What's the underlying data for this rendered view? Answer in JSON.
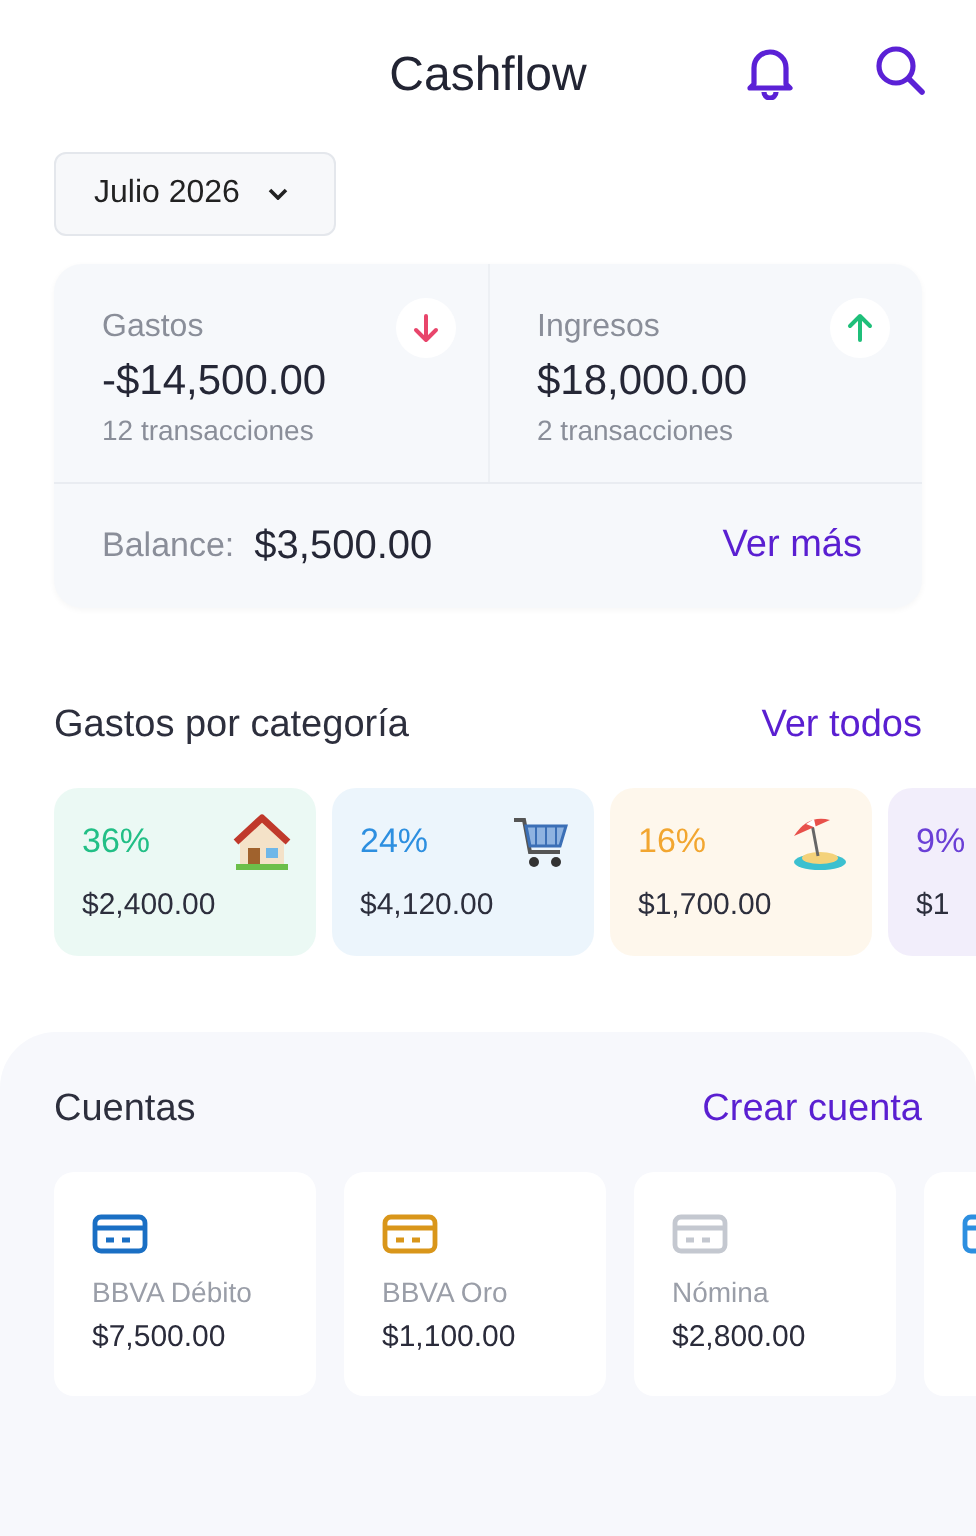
{
  "header": {
    "title": "Cashflow"
  },
  "period": {
    "label": "Julio 2026"
  },
  "summary": {
    "items": [
      {
        "kind": "expense",
        "label": "Gastos",
        "amount": "-$14,500.00",
        "count": "12 transacciones"
      },
      {
        "kind": "income",
        "label": "Ingresos",
        "amount": "$18,000.00",
        "count": "2 transacciones"
      }
    ],
    "balance_label": "Balance:",
    "balance": "$3,500.00",
    "link": "Ver más"
  },
  "categories": {
    "title": "Gastos por categoría",
    "link": "Ver todos",
    "items": [
      {
        "kind": "house",
        "percent": "36%",
        "amount": "$2,400.00",
        "color": "#22bf86"
      },
      {
        "kind": "cart",
        "percent": "24%",
        "amount": "$4,120.00",
        "color": "#2d8fe0"
      },
      {
        "kind": "beach",
        "percent": "16%",
        "amount": "$1,700.00",
        "color": "#f2a630"
      },
      {
        "kind": "none",
        "percent": "9%",
        "amount": "$1",
        "color": "#6a3fd6"
      }
    ]
  },
  "accounts": {
    "title": "Cuentas",
    "link": "Crear cuenta",
    "items": [
      {
        "name": "BBVA Débito",
        "balance": "$7,500.00",
        "color": "#1a6fc4"
      },
      {
        "name": "BBVA Oro",
        "balance": "$1,100.00",
        "color": "#d9961a"
      },
      {
        "name": "Nómina",
        "balance": "$2,800.00",
        "color": "#c4c8d0"
      },
      {
        "color": "#2d8fe0"
      }
    ]
  }
}
